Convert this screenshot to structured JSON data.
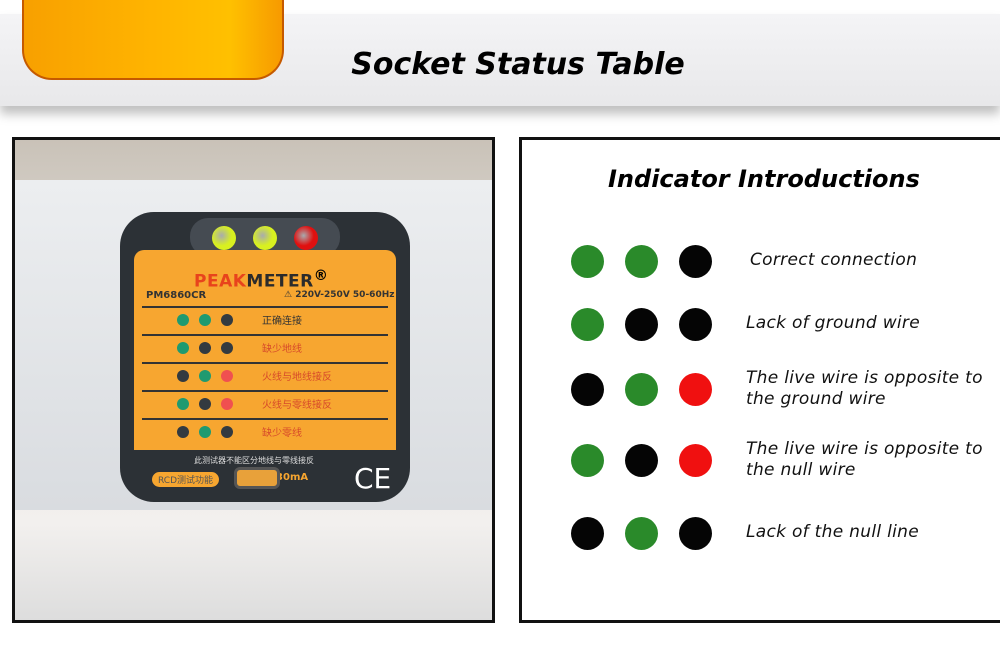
{
  "header": {
    "title": "Socket Status Table"
  },
  "device": {
    "brand_a": "PEAK",
    "brand_b": "METER",
    "registered": "®",
    "model": "PM6860CR",
    "voltage": "⚠ 220V-250V 50-60Hz",
    "rows": [
      {
        "label": "正确连接",
        "dots": [
          "green",
          "green",
          "black"
        ]
      },
      {
        "label": "缺少地线",
        "dots": [
          "green",
          "black",
          "black"
        ]
      },
      {
        "label": "火线与地线接反",
        "dots": [
          "black",
          "green",
          "red"
        ]
      },
      {
        "label": "火线与零线接反",
        "dots": [
          "green",
          "black",
          "red"
        ]
      },
      {
        "label": "缺少零线",
        "dots": [
          "black",
          "green",
          "black"
        ]
      }
    ],
    "warning": "此测试器不能区分地线与零线接反",
    "rcd": "RCD测试功能",
    "idn": "IΔn 30mA",
    "ce": "CE",
    "leds": [
      "#d8f020",
      "#d8f020",
      "#e01010"
    ]
  },
  "indicators": {
    "heading": "Indicator Introductions",
    "rows": [
      {
        "label": "Correct connection",
        "dots": [
          "green",
          "green",
          "black"
        ]
      },
      {
        "label": "Lack of ground wire",
        "dots": [
          "green",
          "black",
          "black"
        ]
      },
      {
        "label": "The live wire is opposite to the ground wire",
        "dots": [
          "black",
          "green",
          "red"
        ]
      },
      {
        "label": "The live wire is opposite to the null wire",
        "dots": [
          "green",
          "black",
          "red"
        ]
      },
      {
        "label": "Lack of the null line",
        "dots": [
          "black",
          "green",
          "black"
        ]
      }
    ]
  },
  "colors": {
    "green": "#2a8a2a",
    "black": "#050505",
    "red": "#f01010",
    "accent": "#ffae00"
  }
}
